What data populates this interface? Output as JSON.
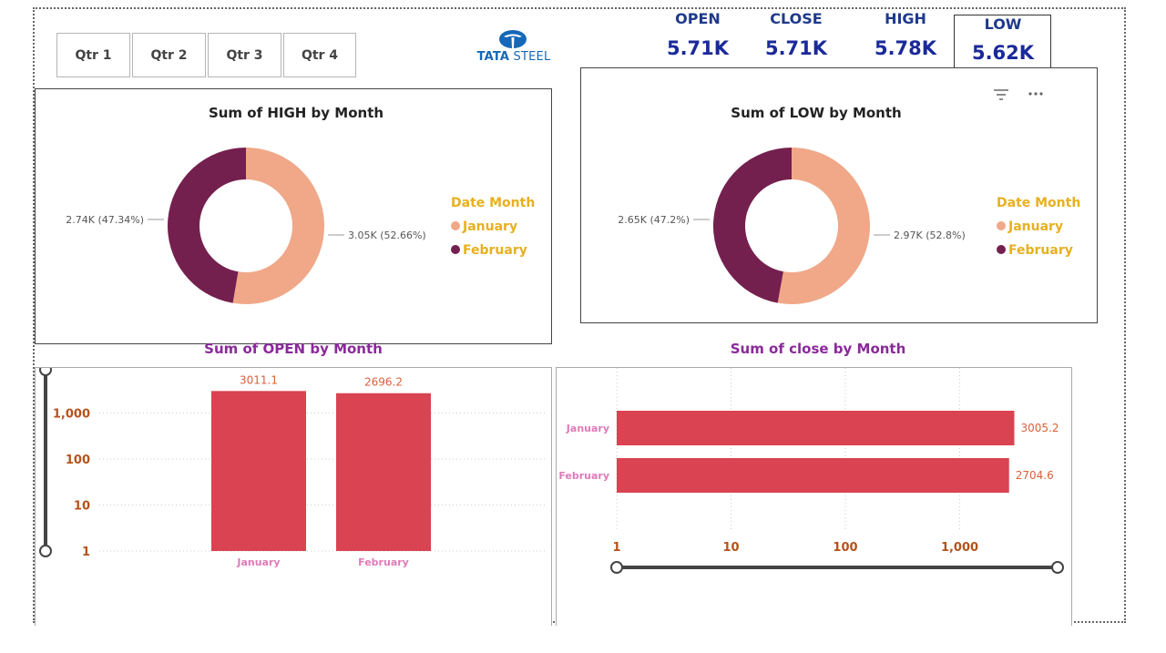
{
  "quarter_buttons": [
    {
      "label": "Qtr 1"
    },
    {
      "label": "Qtr 2"
    },
    {
      "label": "Qtr 3"
    },
    {
      "label": "Qtr 4"
    }
  ],
  "logo": {
    "brand_bold": "TATA",
    "brand_rest": "STEEL",
    "icon": "tata-logo-icon",
    "color": "#1568b8"
  },
  "kpis": [
    {
      "label": "OPEN",
      "value": "5.71K"
    },
    {
      "label": "CLOSE",
      "value": "5.71K"
    },
    {
      "label": "HIGH",
      "value": "5.78K"
    },
    {
      "label": "LOW",
      "value": "5.62K"
    }
  ],
  "visual_header_icons": [
    "filter-icon",
    "more-options-icon"
  ],
  "colors": {
    "january": "#f0a888",
    "february": "#74204e",
    "bar": "#d94352",
    "legend_text": "#e8b020",
    "value_label": "#d9603a",
    "axis_tick": "#b5521a",
    "category_label": "#e07ab8",
    "purple_title": "#8a2a9a"
  },
  "chart_data": [
    {
      "type": "pie",
      "title": "Sum of HIGH by Month",
      "legend_title": "Date  Month",
      "categories": [
        "January",
        "February"
      ],
      "values": [
        3050,
        2740
      ],
      "labels": [
        "3.05K (52.66%)",
        "2.74K (47.34%)"
      ],
      "legend_position": "right"
    },
    {
      "type": "pie",
      "title": "Sum of LOW by Month",
      "legend_title": "Date  Month",
      "categories": [
        "January",
        "February"
      ],
      "values": [
        2970,
        2650
      ],
      "labels": [
        "2.97K (52.8%)",
        "2.65K (47.2%)"
      ],
      "legend_position": "right"
    },
    {
      "type": "bar",
      "orientation": "vertical",
      "title": "Sum of OPEN by Month",
      "categories": [
        "January",
        "February"
      ],
      "values": [
        3011.1,
        2696.2
      ],
      "value_labels": [
        "3011.1",
        "2696.2"
      ],
      "scale": "log",
      "ticks": [
        "1",
        "10",
        "100",
        "1,000"
      ],
      "grid": true
    },
    {
      "type": "bar",
      "orientation": "horizontal",
      "title": "Sum of close by Month",
      "categories": [
        "January",
        "February"
      ],
      "values": [
        3005.2,
        2704.6
      ],
      "value_labels": [
        "3005.2",
        "2704.6"
      ],
      "scale": "log",
      "ticks": [
        "1",
        "10",
        "100",
        "1,000"
      ],
      "grid": true
    }
  ]
}
